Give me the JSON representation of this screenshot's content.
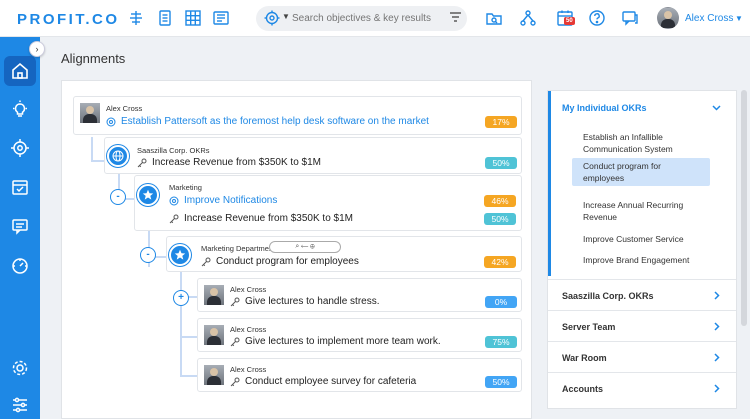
{
  "app": {
    "logo": "PROFIT.CO"
  },
  "search": {
    "placeholder": "Search objectives & key results"
  },
  "notifications": {
    "calendar_badge": "50"
  },
  "user": {
    "name": "Alex Cross"
  },
  "page": {
    "title": "Alignments"
  },
  "tree": {
    "nodes": [
      {
        "owner": "Alex Cross",
        "title": "Establish Pattersoft as the foremost help desk software on the market",
        "progress": "17%",
        "status_color": "#f5a623"
      },
      {
        "owner": "Saaszilla Corp. OKRs",
        "kr_title": "Increase Revenue from $350K to $1M",
        "kr_progress": "50%"
      },
      {
        "owner": "Marketing",
        "title": "Improve Notifications",
        "progress": "46%",
        "kr_title": "Increase Revenue from $350K to $1M",
        "kr_progress": "50%"
      },
      {
        "owner": "Marketing Department OKR",
        "kr_title": "Conduct program for employees",
        "kr_progress": "42%"
      },
      {
        "owner": "Alex Cross",
        "kr_title": "Give lectures to handle stress.",
        "kr_progress": "0%"
      },
      {
        "owner": "Alex Cross",
        "kr_title": "Give lectures to implement more team work.",
        "kr_progress": "75%"
      },
      {
        "owner": "Alex Cross",
        "kr_title": "Conduct employee survey for cafeteria",
        "kr_progress": "50%"
      }
    ],
    "toggles": [
      "-",
      "-",
      "+"
    ]
  },
  "right_panel": {
    "header": "My Individual OKRs",
    "items": [
      "Establish an Infallible Communication System",
      "Conduct program for employees",
      "Increase Annual Recurring Revenue",
      "Improve Customer Service",
      "Improve Brand Engagement"
    ],
    "selected_index": 1,
    "sections": [
      "Saaszilla Corp. OKRs",
      "Server Team",
      "War Room",
      "Accounts"
    ]
  },
  "colors": {
    "brand": "#1e88e5",
    "orange": "#f5a623",
    "teal": "#4fc3d6"
  }
}
